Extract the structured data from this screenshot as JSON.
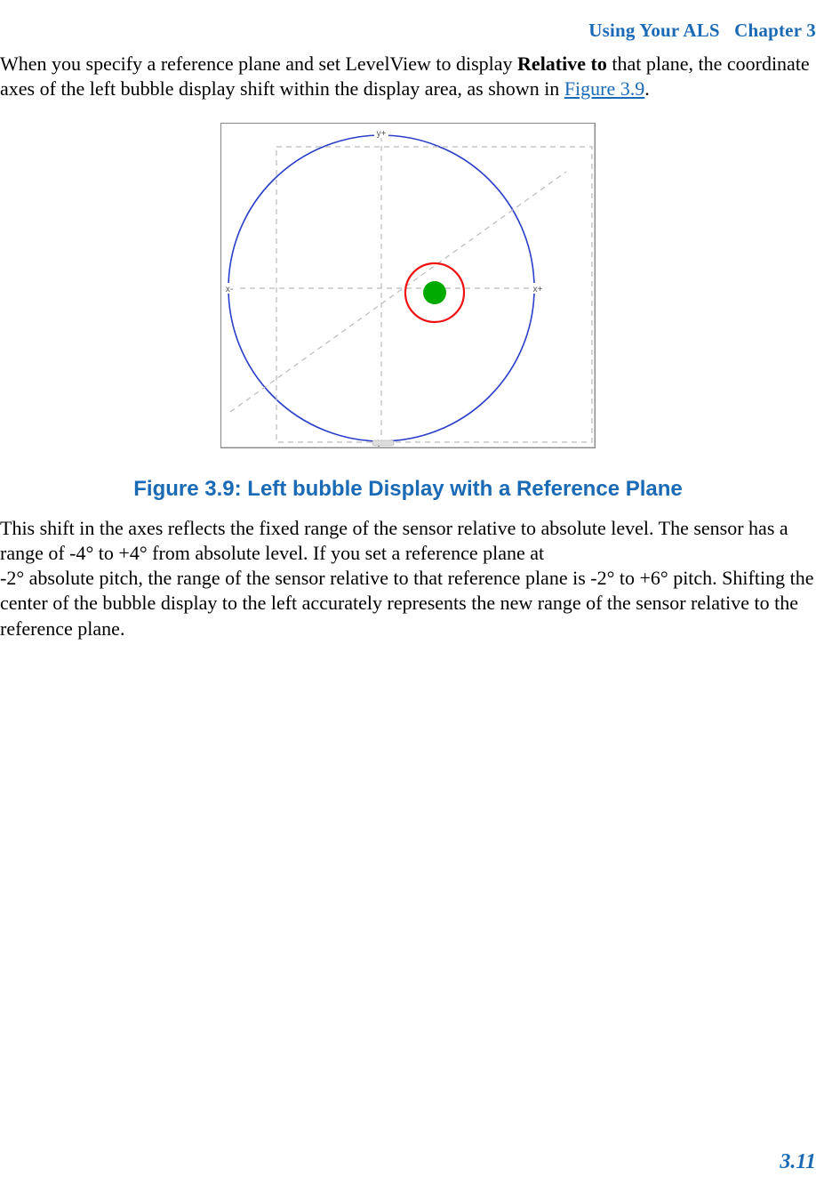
{
  "header": {
    "chapter_title": "Using Your ALS",
    "chapter_label": "Chapter 3"
  },
  "paragraph1": {
    "part1": "When you specify a reference plane and set LevelView to display ",
    "bold": "Relative to",
    "part2": " that plane, the coordinate axes of the left bubble display shift within the display area, as shown in ",
    "figlink": "Figure 3.9",
    "part3": "."
  },
  "figure": {
    "caption": "Figure 3.9: Left bubble Display with a Reference Plane",
    "axis_labels": {
      "y_plus": "y+",
      "y_minus": "y-",
      "x_plus": "x+",
      "x_minus": "x-"
    }
  },
  "paragraph2": "This shift in the axes reflects the fixed range of the sensor relative to absolute level. The sensor has a range of -4° to +4° from absolute level. If you set a reference plane at",
  "paragraph3": "-2° absolute pitch, the range of the sensor relative to that reference plane is -2° to +6° pitch. Shifting the center of the bubble display to the left accurately represents the new range of the sensor relative to the reference plane.",
  "page_number": "3.11"
}
